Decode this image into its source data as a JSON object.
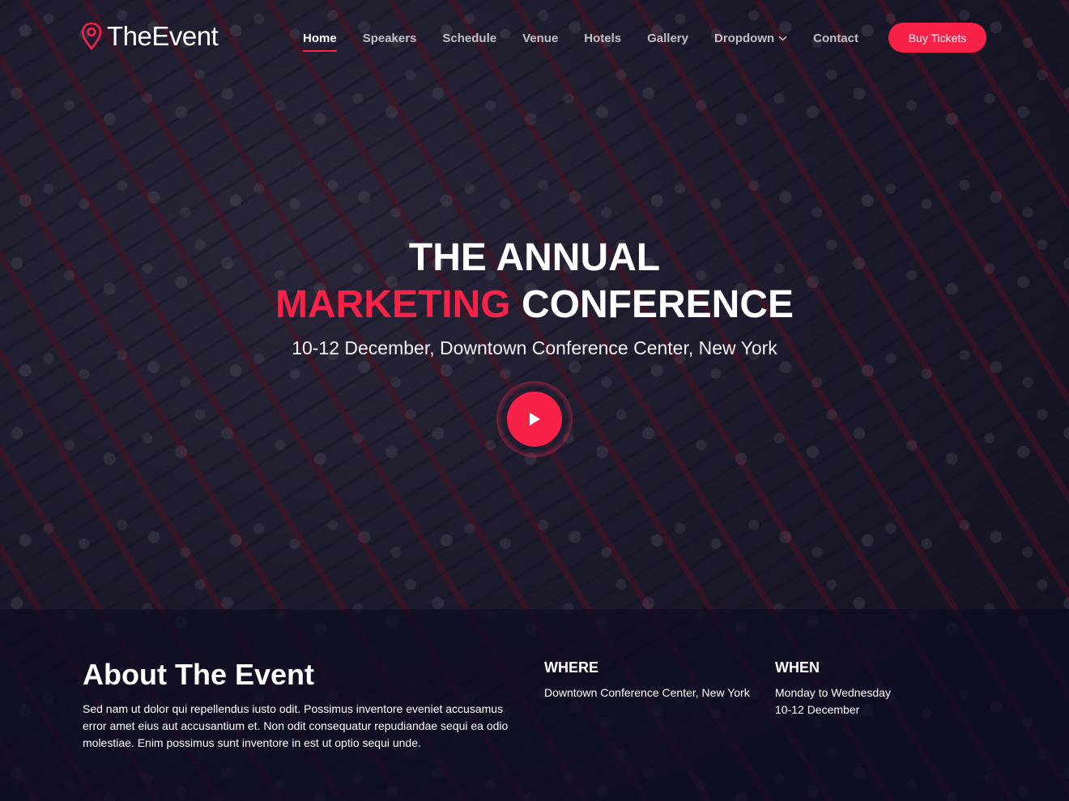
{
  "colors": {
    "accent": "#f82249",
    "overlay": "#0c0d23"
  },
  "header": {
    "logo_prefix": "The",
    "logo_accent": "E",
    "logo_suffix": "vent",
    "nav": [
      {
        "label": "Home",
        "active": true
      },
      {
        "label": "Speakers"
      },
      {
        "label": "Schedule"
      },
      {
        "label": "Venue"
      },
      {
        "label": "Hotels"
      },
      {
        "label": "Gallery"
      },
      {
        "label": "Dropdown"
      },
      {
        "label": "Contact"
      }
    ],
    "buy_tickets": "Buy Tickets"
  },
  "hero": {
    "title_line1": "The Annual",
    "title_accent": "Marketing",
    "title_rest": "Conference",
    "subtitle": "10-12 December, Downtown Conference Center, New York",
    "play_icon": "play-icon"
  },
  "about": {
    "title": "About The Event",
    "text": "Sed nam ut dolor qui repellendus iusto odit. Possimus inventore eveniet accusamus error amet eius aut accusantium et. Non odit consequatur repudiandae sequi ea odio molestiae. Enim possimus sunt inventore in est ut optio sequi unde.",
    "where_title": "Where",
    "where_text": "Downtown Conference Center, New York",
    "when_title": "When",
    "when_line1": "Monday to Wednesday",
    "when_line2": "10-12 December"
  }
}
